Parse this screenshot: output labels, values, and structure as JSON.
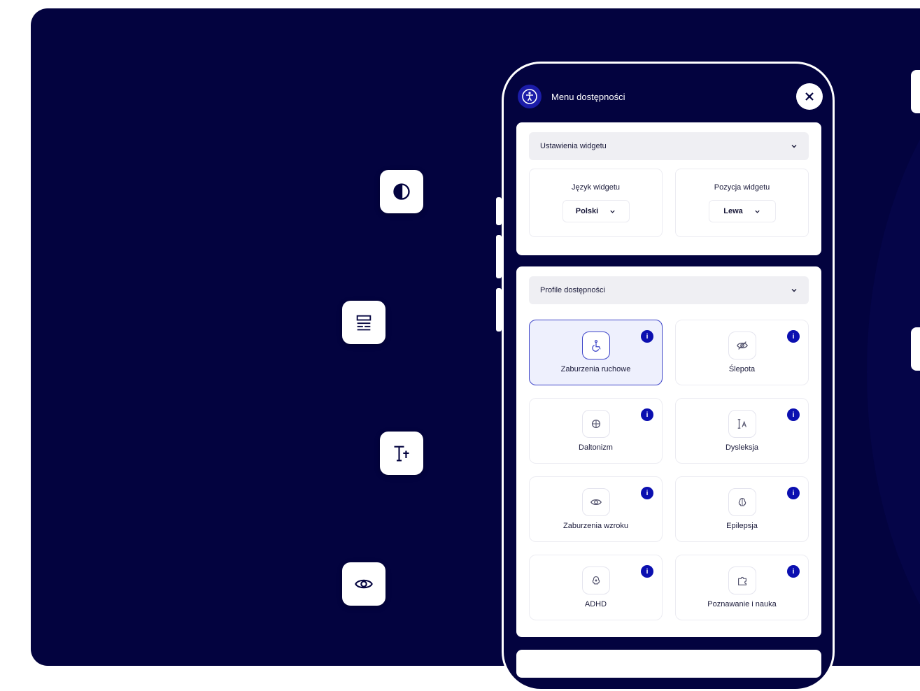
{
  "header": {
    "title": "Menu dostępności",
    "logo_icon": "accessibility-person-icon",
    "close_icon": "close-icon"
  },
  "widget_settings": {
    "title": "Ustawienia widgetu",
    "language": {
      "label": "Język widgetu",
      "value": "Polski"
    },
    "position": {
      "label": "Pozycja widgetu",
      "value": "Lewa"
    }
  },
  "profiles": {
    "title": "Profile dostępności",
    "items": [
      {
        "name": "Zaburzenia ruchowe",
        "icon": "wheelchair-icon",
        "active": true
      },
      {
        "name": "Ślepota",
        "icon": "eye-off-icon",
        "active": false
      },
      {
        "name": "Daltonizm",
        "icon": "color-blind-icon",
        "active": false
      },
      {
        "name": "Dysleksja",
        "icon": "text-cursor-icon",
        "active": false
      },
      {
        "name": "Zaburzenia wzroku",
        "icon": "eye-icon",
        "active": false
      },
      {
        "name": "Epilepsja",
        "icon": "brain-icon",
        "active": false
      },
      {
        "name": "ADHD",
        "icon": "focus-icon",
        "active": false
      },
      {
        "name": "Poznawanie i nauka",
        "icon": "puzzle-icon",
        "active": false
      }
    ],
    "info_glyph": "i"
  },
  "floating_buttons": [
    {
      "icon": "contrast-icon"
    },
    {
      "icon": "line-spacing-icon"
    },
    {
      "icon": "text-size-icon"
    },
    {
      "icon": "eye-icon"
    }
  ],
  "colors": {
    "background": "#03033f",
    "accent": "#0b0fb0",
    "active_profile_bg": "#eef0fd"
  }
}
